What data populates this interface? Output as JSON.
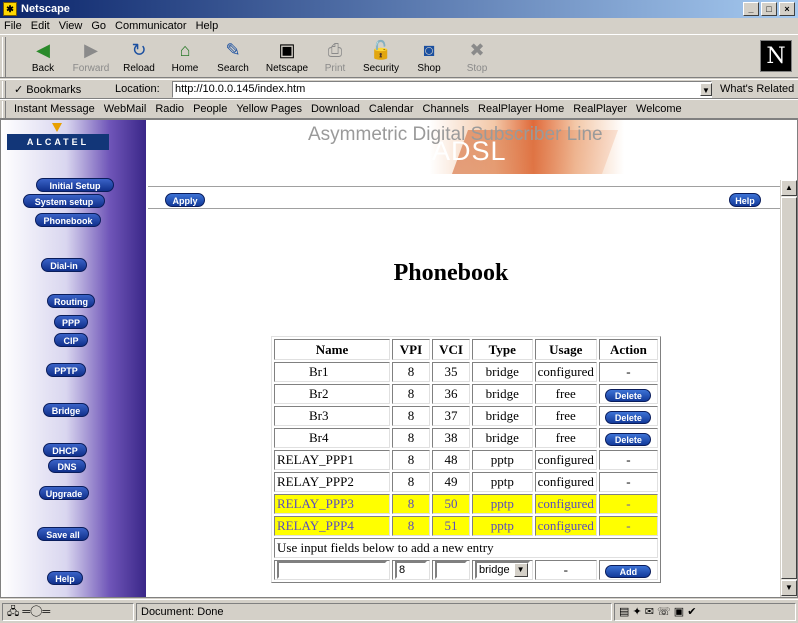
{
  "window": {
    "title": "Netscape",
    "buttons": [
      "_",
      "□",
      "×"
    ]
  },
  "menu": [
    "File",
    "Edit",
    "View",
    "Go",
    "Communicator",
    "Help"
  ],
  "toolbar": {
    "buttons": [
      {
        "label": "Back",
        "icon": "◀",
        "enabled": true
      },
      {
        "label": "Forward",
        "icon": "▶",
        "enabled": false
      },
      {
        "label": "Reload",
        "icon": "↻",
        "enabled": true
      },
      {
        "label": "Home",
        "icon": "⌂",
        "enabled": true
      },
      {
        "label": "Search",
        "icon": "✎",
        "enabled": true
      },
      {
        "label": "Netscape",
        "icon": "▣",
        "enabled": true
      },
      {
        "label": "Print",
        "icon": "⎙",
        "enabled": false
      },
      {
        "label": "Security",
        "icon": "🔓",
        "enabled": true
      },
      {
        "label": "Shop",
        "icon": "◙",
        "enabled": true
      },
      {
        "label": "Stop",
        "icon": "✖",
        "enabled": false
      }
    ],
    "logo": "N"
  },
  "location": {
    "bookmarks_label": "Bookmarks",
    "label": "Location:",
    "url": "http://10.0.0.145/index.htm",
    "related": "What's Related"
  },
  "personal_toolbar": [
    "Instant Message",
    "WebMail",
    "Radio",
    "People",
    "Yellow Pages",
    "Download",
    "Calendar",
    "Channels",
    "RealPlayer Home",
    "RealPlayer",
    "Welcome"
  ],
  "sidebar": {
    "logo": "ALCATEL",
    "nav": [
      "Initial Setup",
      "System setup",
      "Phonebook",
      "Dial-in",
      "Routing",
      "PPP",
      "CIP",
      "PPTP",
      "Bridge",
      "DHCP",
      "DNS",
      "Upgrade",
      "Save all",
      "Help"
    ]
  },
  "banner": {
    "line": "Asymmetric Digital Subscriber Line",
    "big": "ADSL"
  },
  "actions": {
    "apply": "Apply",
    "help": "Help"
  },
  "page_title": "Phonebook",
  "table": {
    "headers": [
      "Name",
      "VPI",
      "VCI",
      "Type",
      "Usage",
      "Action"
    ],
    "rows": [
      {
        "name": "Br1",
        "vpi": "8",
        "vci": "35",
        "type": "bridge",
        "usage": "configured",
        "action": "-",
        "highlight": false
      },
      {
        "name": "Br2",
        "vpi": "8",
        "vci": "36",
        "type": "bridge",
        "usage": "free",
        "action": "Delete",
        "highlight": false
      },
      {
        "name": "Br3",
        "vpi": "8",
        "vci": "37",
        "type": "bridge",
        "usage": "free",
        "action": "Delete",
        "highlight": false
      },
      {
        "name": "Br4",
        "vpi": "8",
        "vci": "38",
        "type": "bridge",
        "usage": "free",
        "action": "Delete",
        "highlight": false
      },
      {
        "name": "RELAY_PPP1",
        "vpi": "8",
        "vci": "48",
        "type": "pptp",
        "usage": "configured",
        "action": "-",
        "highlight": false
      },
      {
        "name": "RELAY_PPP2",
        "vpi": "8",
        "vci": "49",
        "type": "pptp",
        "usage": "configured",
        "action": "-",
        "highlight": false
      },
      {
        "name": "RELAY_PPP3",
        "vpi": "8",
        "vci": "50",
        "type": "pptp",
        "usage": "configured",
        "action": "-",
        "highlight": true
      },
      {
        "name": "RELAY_PPP4",
        "vpi": "8",
        "vci": "51",
        "type": "pptp",
        "usage": "configured",
        "action": "-",
        "highlight": true
      }
    ],
    "add_note": "Use input fields below to add a new entry",
    "new_entry": {
      "name": "",
      "vpi": "8",
      "vci": "",
      "type": "bridge",
      "usage": "-",
      "add_label": "Add"
    }
  },
  "status": {
    "text": "Document: Done"
  },
  "colors": {
    "highlight": "#ffff00",
    "highlight_text": "#5a4cc0",
    "button_blue": "#1e4bb0"
  }
}
